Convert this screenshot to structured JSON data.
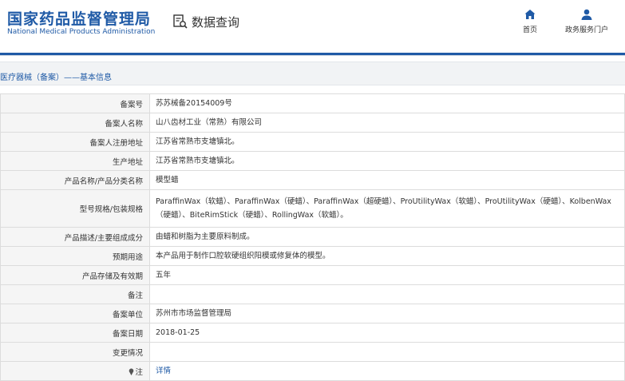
{
  "header": {
    "logo_cn": "国家药品监督管理局",
    "logo_en": "National Medical Products Administration",
    "query_label": "数据查询",
    "nav": [
      {
        "label": "首页",
        "icon": "home-icon"
      },
      {
        "label": "政务服务门户",
        "icon": "user-icon"
      }
    ]
  },
  "breadcrumb": "医疗器械（备案）——基本信息",
  "rows": [
    {
      "label": "备案号",
      "value": "苏苏械备20154009号"
    },
    {
      "label": "备案人名称",
      "value": "山八齿材工业（常熟）有限公司"
    },
    {
      "label": "备案人注册地址",
      "value": "江苏省常熟市支塘镇北。"
    },
    {
      "label": "生产地址",
      "value": "江苏省常熟市支塘镇北。"
    },
    {
      "label": "产品名称/产品分类名称",
      "value": "模型蜡"
    },
    {
      "label": "型号规格/包装规格",
      "value": "ParaffinWax（软蜡）、ParaffinWax（硬蜡）、ParaffinWax（超硬蜡）、ProUtilityWax（软蜡）、ProUtilityWax（硬蜡）、KolbenWax（硬蜡）、BiteRimStick（硬蜡）、RollingWax（软蜡）。"
    },
    {
      "label": "产品描述/主要组成成分",
      "value": "由蜡和树脂为主要原料制成。"
    },
    {
      "label": "预期用途",
      "value": "本产品用于制作口腔软硬组织阳模或修复体的模型。"
    },
    {
      "label": "产品存储及有效期",
      "value": "五年"
    },
    {
      "label": "备注",
      "value": ""
    },
    {
      "label": "备案单位",
      "value": "苏州市市场监督管理局"
    },
    {
      "label": "备案日期",
      "value": "2018-01-25"
    },
    {
      "label": "变更情况",
      "value": ""
    },
    {
      "label": "注",
      "value": "详情"
    }
  ],
  "colors": {
    "brand": "#1f5aa6",
    "label_bg": "#f5f5f5",
    "border": "#dcdcdc"
  }
}
